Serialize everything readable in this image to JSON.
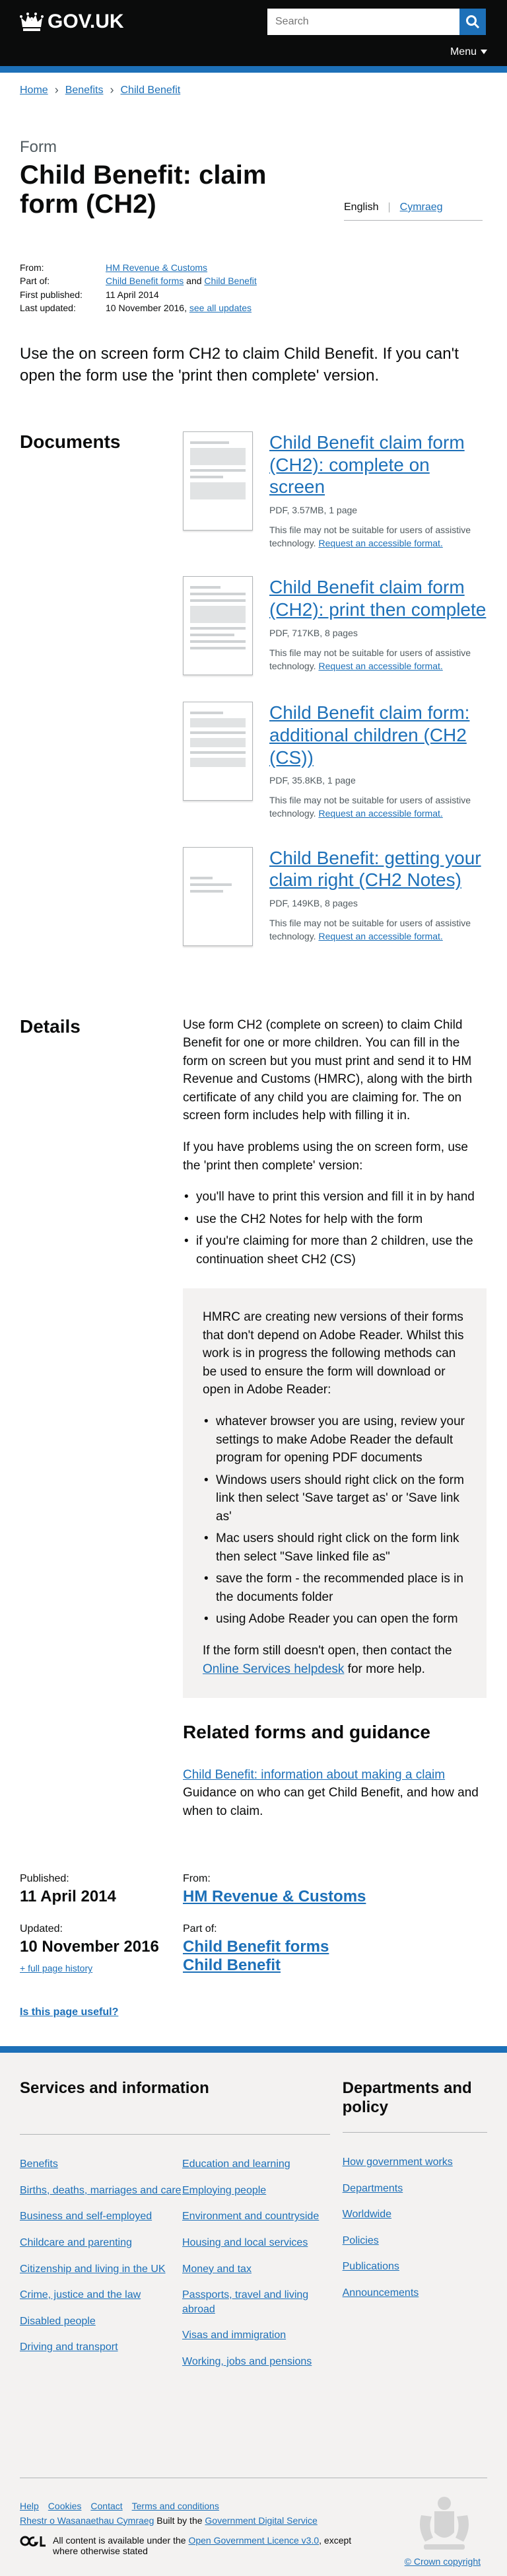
{
  "header": {
    "logo_text": "GOV.UK",
    "search_placeholder": "Search",
    "menu_label": "Menu",
    "brand_color": "#1d70b8"
  },
  "breadcrumbs": [
    "Home",
    "Benefits",
    "Child Benefit"
  ],
  "page": {
    "doc_type": "Form",
    "title": "Child Benefit: claim form (CH2)",
    "lang_english": "English",
    "lang_welsh": "Cymraeg"
  },
  "meta": {
    "from_label": "From:",
    "from_value": "HM Revenue & Customs",
    "part_label": "Part of:",
    "part_1": "Child Benefit forms",
    "part_and": "and",
    "part_2": "Child Benefit",
    "first_published_label": "First published:",
    "first_published_value": "11 April 2014",
    "last_updated_label": "Last updated:",
    "last_updated_value": "10 November 2016,",
    "see_all_updates": "see all updates"
  },
  "lead": "Use the on screen form CH2 to claim Child Benefit. If you can't open the form use the 'print then complete' version.",
  "documents": {
    "heading": "Documents",
    "note_prefix": "This file may not be suitable for users of assistive technology.",
    "note_link": "Request an accessible format.",
    "items": [
      {
        "title": "Child Benefit claim form (CH2): complete on screen",
        "meta": "PDF, 3.57MB, 1 page"
      },
      {
        "title": "Child Benefit claim form (CH2): print then complete",
        "meta": "PDF, 717KB, 8 pages"
      },
      {
        "title": "Child Benefit claim form: additional children (CH2 (CS))",
        "meta": "PDF, 35.8KB, 1 page"
      },
      {
        "title": "Child Benefit: getting your claim right (CH2 Notes)",
        "meta": "PDF, 149KB, 8 pages"
      }
    ]
  },
  "details": {
    "heading": "Details",
    "para1": "Use form CH2 (complete on screen) to claim Child Benefit for one or more children. You can fill in the form on screen but you must print and send it to HM Revenue and Customs (HMRC), along with the birth certificate of any child you are claiming for. The on screen form includes help with filling it in.",
    "para2": "If you have problems using the on screen form, use the 'print then complete' version:",
    "list": [
      "you'll have to print this version and fill it in by hand",
      "use the CH2 Notes for help with the form",
      "if you're claiming for more than 2 children, use the continuation sheet CH2 (CS)"
    ],
    "callout_intro": "HMRC are creating new versions of their forms that don't depend on Adobe Reader. Whilst this work is in progress the following methods can be used to ensure the form will download or open in Adobe Reader:",
    "callout_list": [
      "whatever browser you are using, review your settings to make Adobe Reader the default program for opening PDF documents",
      "Windows users should right click on the form link then select 'Save target as' or 'Save link as'",
      "Mac users should right click on the form link then select \"Save linked file as\"",
      "save the form - the recommended place is in the documents folder",
      "using Adobe Reader you can open the form"
    ],
    "callout_outro_prefix": "If the form still doesn't open, then contact the",
    "callout_outro_link": "Online Services helpdesk",
    "callout_outro_suffix": "for more help.",
    "related_heading": "Related forms and guidance",
    "related_link": "Child Benefit: information about making a claim",
    "related_desc": "Guidance on who can get Child Benefit, and how and when to claim."
  },
  "published": {
    "published_label": "Published:",
    "published_value": "11 April 2014",
    "updated_label": "Updated:",
    "updated_value": "10 November 2016",
    "history_link": "+ full page history",
    "from_label": "From:",
    "from_value": "HM Revenue & Customs",
    "part_label": "Part of:",
    "part_1": "Child Benefit forms",
    "part_2": "Child Benefit"
  },
  "feedback": "Is this page useful?",
  "footer": {
    "services_heading": "Services and information",
    "services_col1": [
      "Benefits",
      "Births, deaths, marriages and care",
      "Business and self-employed",
      "Childcare and parenting",
      "Citizenship and living in the UK",
      "Crime, justice and the law",
      "Disabled people",
      "Driving and transport"
    ],
    "services_col2": [
      "Education and learning",
      "Employing people",
      "Environment and countryside",
      "Housing and local services",
      "Money and tax",
      "Passports, travel and living abroad",
      "Visas and immigration",
      "Working, jobs and pensions"
    ],
    "depts_heading": "Departments and policy",
    "depts": [
      "How government works",
      "Departments",
      "Worldwide",
      "Policies",
      "Publications",
      "Announcements"
    ],
    "meta_links": [
      "Help",
      "Cookies",
      "Contact",
      "Terms and conditions"
    ],
    "welsh_link": "Rhestr o Wasanaethau Cymraeg",
    "built_prefix": "Built by the",
    "built_link": "Government Digital Service",
    "licence_prefix": "All content is available under the",
    "licence_link": "Open Government Licence v3.0",
    "licence_suffix": ", except where otherwise stated",
    "copyright": "© Crown copyright"
  }
}
